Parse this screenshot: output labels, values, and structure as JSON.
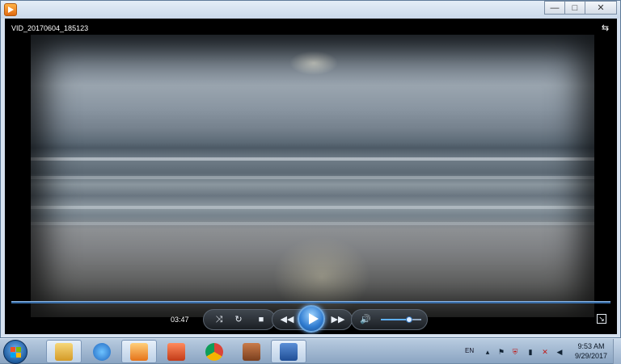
{
  "window": {
    "title": "",
    "controls": {
      "minimize": "—",
      "maximize": "□",
      "close": "✕"
    }
  },
  "player": {
    "video_title": "VID_20170604_185123",
    "elapsed_time": "03:47",
    "playback_progress": 1.0,
    "volume_level": 0.7
  },
  "icons": {
    "switch_to_library": "switch-to-library-icon",
    "shuffle": "shuffle-icon",
    "repeat": "repeat-icon",
    "stop": "stop-icon",
    "previous": "previous-icon",
    "play": "play-icon",
    "next": "next-icon",
    "mute": "volume-icon",
    "fullscreen": "fullscreen-icon"
  },
  "taskbar": {
    "items": [
      {
        "name": "windows-explorer",
        "color": "#e8b94a"
      },
      {
        "name": "internet-explorer",
        "color": "#2a7fd4"
      },
      {
        "name": "windows-media-player",
        "color": "#f09a2a"
      },
      {
        "name": "powerpoint",
        "color": "#d24726"
      },
      {
        "name": "chrome",
        "color": "#4caf50"
      },
      {
        "name": "winrar",
        "color": "#a0522d"
      },
      {
        "name": "word",
        "color": "#2b5797"
      }
    ],
    "language": "EN",
    "clock_time": "9:53 AM",
    "clock_date": "9/29/2017"
  }
}
